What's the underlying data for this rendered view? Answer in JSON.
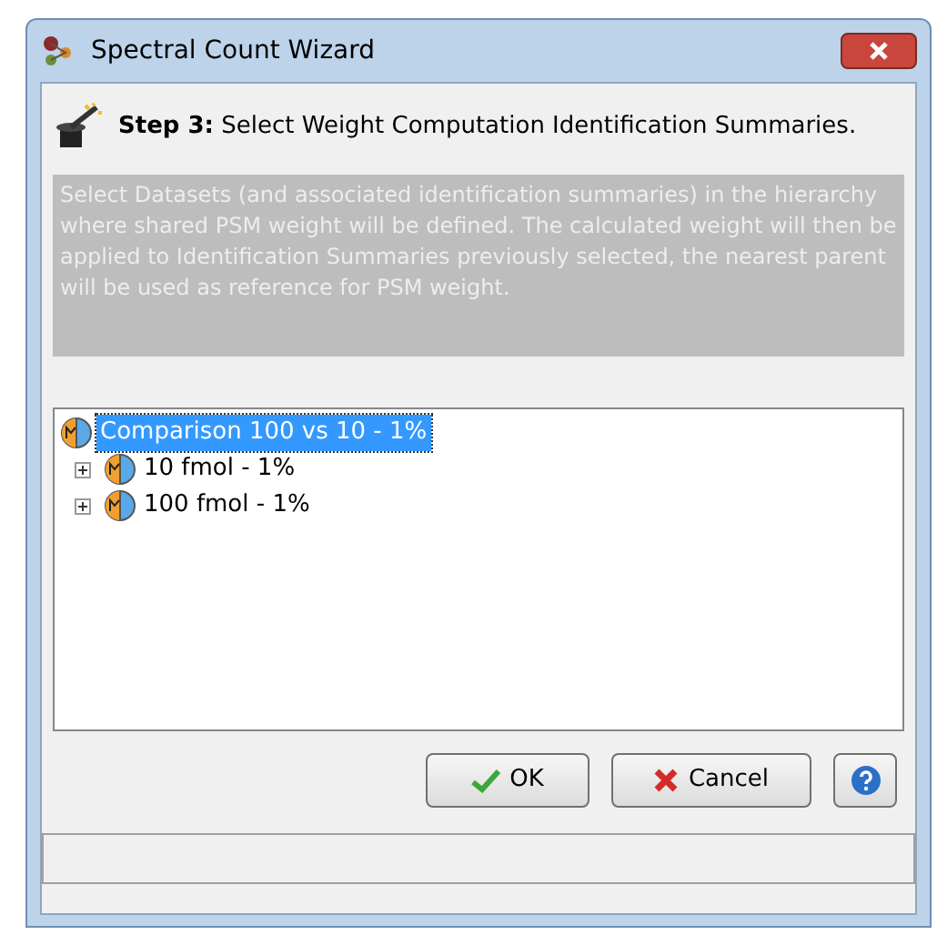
{
  "window": {
    "title": "Spectral Count Wizard"
  },
  "step": {
    "text": "**Step 3:** Select Weight Computation Identification Summaries."
  },
  "description": "Select Datasets (and associated identification summaries) in the hierarchy where shared PSM weight will be defined. The calculated weight will then be applied to Identification Summaries previously selected, the nearest parent will be used as reference for PSM weight.",
  "tree": [
    {
      "label": "Comparison 100 vs 10 - 1%",
      "selected": true,
      "children": [
        {
          "label": "10 fmol - 1%",
          "selected": false,
          "expanded": false
        },
        {
          "label": "100 fmol - 1%",
          "selected": false,
          "expanded": false
        }
      ]
    }
  ],
  "buttons": [
    {
      "kind": "ok",
      "label": "OK"
    },
    {
      "kind": "cancel",
      "label": "Cancel"
    },
    {
      "kind": "help"
    }
  ]
}
